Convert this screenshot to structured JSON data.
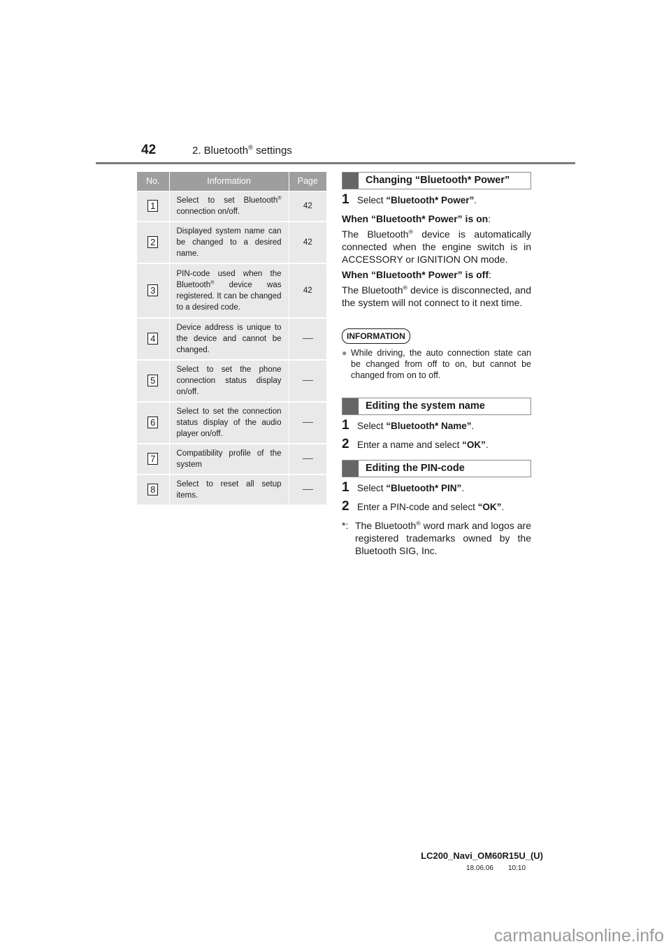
{
  "header": {
    "page_number": "42",
    "section_title_pre": "2. Bluetooth",
    "section_title_reg": "®",
    "section_title_post": " settings"
  },
  "table": {
    "columns": [
      "No.",
      "Information",
      "Page"
    ],
    "rows": [
      {
        "no": "1",
        "info_pre": "Select to set Bluetooth",
        "info_reg": "®",
        "info_post": " connection on/off.",
        "page": "42"
      },
      {
        "no": "2",
        "info_pre": "Displayed system name can be changed to a desired name.",
        "info_reg": "",
        "info_post": "",
        "page": "42"
      },
      {
        "no": "3",
        "info_pre": "PIN-code used when the Bluetooth",
        "info_reg": "®",
        "info_post": " device was registered. It can be changed to a desired code.",
        "page": "42"
      },
      {
        "no": "4",
        "info_pre": "Device address is unique to the device and cannot be changed.",
        "info_reg": "",
        "info_post": "",
        "page": "—"
      },
      {
        "no": "5",
        "info_pre": "Select to set the phone connection status display on/off.",
        "info_reg": "",
        "info_post": "",
        "page": "—"
      },
      {
        "no": "6",
        "info_pre": "Select to set the connection status display of the audio player on/off.",
        "info_reg": "",
        "info_post": "",
        "page": "—"
      },
      {
        "no": "7",
        "info_pre": "Compatibility profile of the system",
        "info_reg": "",
        "info_post": "",
        "page": "—"
      },
      {
        "no": "8",
        "info_pre": "Select to reset all setup items.",
        "info_reg": "",
        "info_post": "",
        "page": "—"
      }
    ]
  },
  "sections": {
    "power": {
      "title": "Changing “Bluetooth* Power”",
      "step1": {
        "num": "1",
        "pre": "Select ",
        "bold": "“Bluetooth* Power”",
        "post": "."
      },
      "on_heading": "When “Bluetooth* Power” is on",
      "on_text_pre": "The Bluetooth",
      "on_text_post": " device is automatically connected when the engine switch is in ACCESSORY or IGNITION ON mode.",
      "off_heading": "When “Bluetooth* Power” is off",
      "off_text_pre": "The Bluetooth",
      "off_text_post": " device is disconnected, and the system will not connect to it next time."
    },
    "information": {
      "badge": "INFORMATION",
      "bullet": "●",
      "text": "While driving, the auto connection state can be changed from off to on, but cannot be changed from on to off."
    },
    "name": {
      "title": "Editing the system name",
      "step1": {
        "num": "1",
        "pre": "Select ",
        "bold": "“Bluetooth* Name”",
        "post": "."
      },
      "step2": {
        "num": "2",
        "pre": "Enter a name and select ",
        "bold": "“OK”",
        "post": "."
      }
    },
    "pin": {
      "title": "Editing the PIN-code",
      "step1": {
        "num": "1",
        "pre": "Select ",
        "bold": "“Bluetooth* PIN”",
        "post": "."
      },
      "step2": {
        "num": "2",
        "pre": "Enter a PIN-code and select ",
        "bold": "“OK”",
        "post": "."
      }
    },
    "footnote": {
      "mark": "*:",
      "pre": "The Bluetooth",
      "post": " word mark and logos are registered trademarks owned by the Bluetooth SIG, Inc."
    },
    "reg": "®",
    "colon": ":"
  },
  "footer": {
    "doc_id": "LC200_Navi_OM60R15U_(U)",
    "date": "18.06.06",
    "time": "10:10",
    "watermark": "carmanualsonline.info"
  }
}
